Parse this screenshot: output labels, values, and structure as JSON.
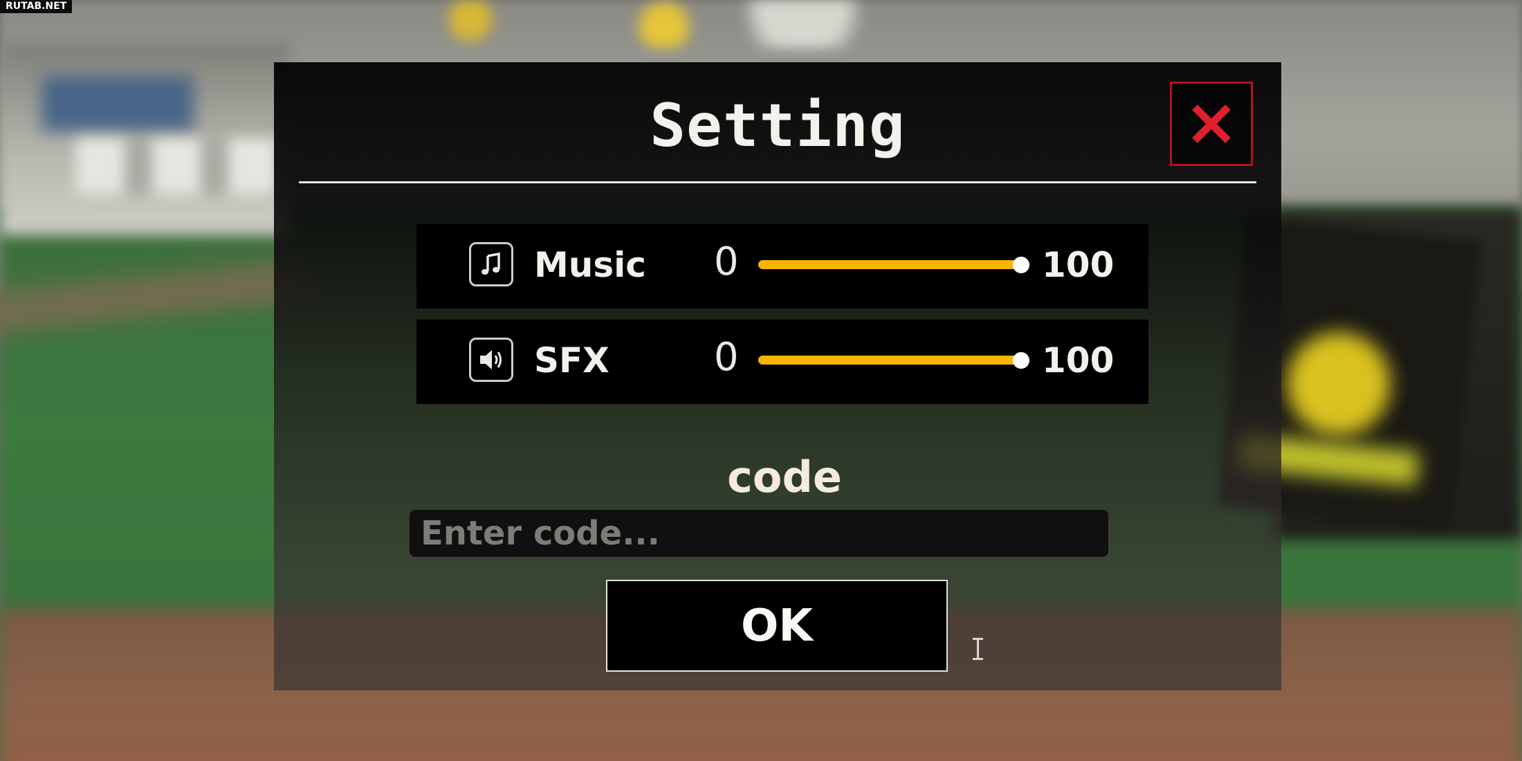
{
  "watermark": "RUTAB.NET",
  "dialog": {
    "title": "Setting",
    "close_icon": "close-x-icon",
    "close_color": "#e0202c"
  },
  "audio": [
    {
      "icon": "music-note-icon",
      "label": "Music",
      "min": "0",
      "max": "100",
      "value": 100
    },
    {
      "icon": "speaker-icon",
      "label": "SFX",
      "min": "0",
      "max": "100",
      "value": 100
    }
  ],
  "slider_colors": {
    "fill": "#f7b500",
    "knob": "#ffffff"
  },
  "code": {
    "label": "code",
    "placeholder": "Enter code...",
    "value": ""
  },
  "ok_button": {
    "label": "OK"
  }
}
